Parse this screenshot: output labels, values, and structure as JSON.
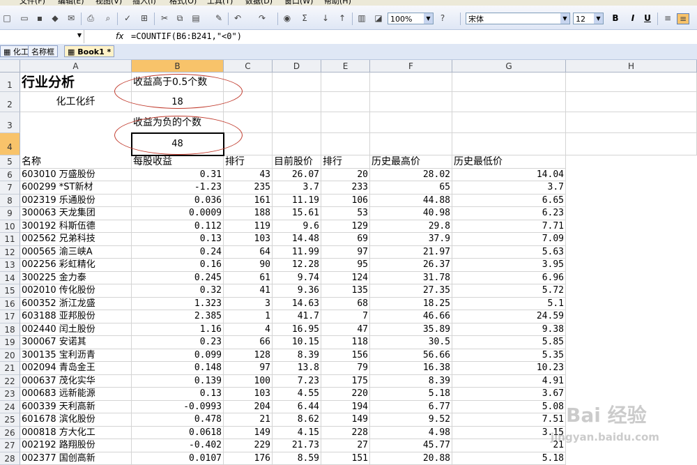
{
  "menu": [
    "文件(F)",
    "编辑(E)",
    "视图(V)",
    "插入(I)",
    "格式(O)",
    "工具(T)",
    "数据(D)",
    "窗口(W)",
    "帮助(H)"
  ],
  "toolbar": {
    "zoom": "100%",
    "font": "宋体",
    "font_size": "12",
    "bold": "B",
    "italic": "I",
    "underline": "U"
  },
  "formula_bar": {
    "fx": "fx",
    "formula": "=COUNTIF(B6:B241,\"<0\")"
  },
  "tabs": [
    "化工",
    "名称框",
    "Book1 *"
  ],
  "columns": [
    "A",
    "B",
    "C",
    "D",
    "E",
    "F",
    "G",
    "H"
  ],
  "header_cells": {
    "a1": "行业分析",
    "a2": "化工化纤",
    "b1": "收益高于0.5个数",
    "b2": "18",
    "b3": "收益为负的个数",
    "b4": "48"
  },
  "table": {
    "headers": [
      "名称",
      "每股收益",
      "排行",
      "目前股价",
      "排行",
      "历史最高价",
      "历史最低价"
    ],
    "rows": [
      [
        "603010 万盛股份",
        "0.31",
        "43",
        "26.07",
        "20",
        "28.02",
        "14.04"
      ],
      [
        "600299 *ST新材",
        "-1.23",
        "235",
        "3.7",
        "233",
        "65",
        "3.7"
      ],
      [
        "002319 乐通股份",
        "0.036",
        "161",
        "11.19",
        "106",
        "44.88",
        "6.65"
      ],
      [
        "300063 天龙集团",
        "0.0009",
        "188",
        "15.61",
        "53",
        "40.98",
        "6.23"
      ],
      [
        "300192 科斯伍德",
        "0.112",
        "119",
        "9.6",
        "129",
        "29.8",
        "7.71"
      ],
      [
        "002562 兄弟科技",
        "0.13",
        "103",
        "14.48",
        "69",
        "37.9",
        "7.09"
      ],
      [
        "000565 渝三峡A",
        "0.24",
        "64",
        "11.99",
        "97",
        "21.97",
        "5.63"
      ],
      [
        "002256 彩虹精化",
        "0.16",
        "90",
        "12.28",
        "95",
        "26.37",
        "3.95"
      ],
      [
        "300225 金力泰",
        "0.245",
        "61",
        "9.74",
        "124",
        "31.78",
        "6.96"
      ],
      [
        "002010 传化股份",
        "0.32",
        "41",
        "9.36",
        "135",
        "27.35",
        "5.72"
      ],
      [
        "600352 浙江龙盛",
        "1.323",
        "3",
        "14.63",
        "68",
        "18.25",
        "5.1"
      ],
      [
        "603188 亚邦股份",
        "2.385",
        "1",
        "41.7",
        "7",
        "46.66",
        "24.59"
      ],
      [
        "002440 闰土股份",
        "1.16",
        "4",
        "16.95",
        "47",
        "35.89",
        "9.38"
      ],
      [
        "300067 安诺其",
        "0.23",
        "66",
        "10.15",
        "118",
        "30.5",
        "5.85"
      ],
      [
        "300135 宝利沥青",
        "0.099",
        "128",
        "8.39",
        "156",
        "56.66",
        "5.35"
      ],
      [
        "002094 青岛金王",
        "0.148",
        "97",
        "13.8",
        "79",
        "16.38",
        "10.23"
      ],
      [
        "000637 茂化实华",
        "0.139",
        "100",
        "7.23",
        "175",
        "8.39",
        "4.91"
      ],
      [
        "000683 远新能源",
        "0.13",
        "103",
        "4.55",
        "220",
        "5.18",
        "3.67"
      ],
      [
        "600339 天利高新",
        "-0.0993",
        "204",
        "6.44",
        "194",
        "6.77",
        "5.08"
      ],
      [
        "601678 滨化股份",
        "0.478",
        "21",
        "8.62",
        "149",
        "9.52",
        "7.51"
      ],
      [
        "000818 方大化工",
        "0.0618",
        "149",
        "4.15",
        "228",
        "4.98",
        "3.15"
      ],
      [
        "002192 路翔股份",
        "-0.402",
        "229",
        "21.73",
        "27",
        "45.77",
        "21"
      ],
      [
        "002377 国创高新",
        "0.0107",
        "176",
        "8.59",
        "151",
        "20.88",
        "5.18"
      ]
    ]
  },
  "watermark": "Bai 经验",
  "watermark_url": "jingyan.baidu.com"
}
